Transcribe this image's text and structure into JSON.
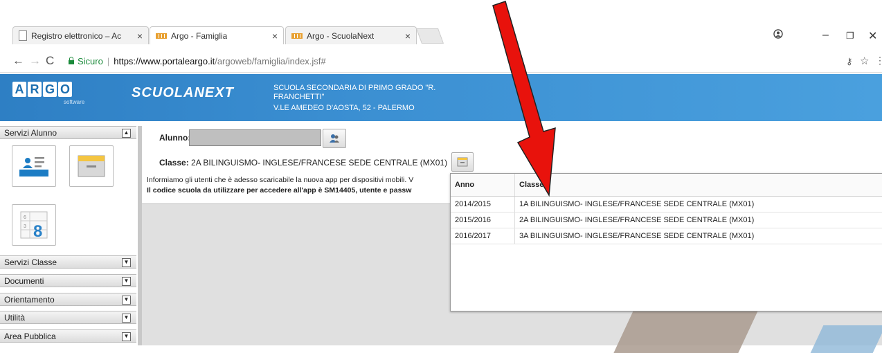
{
  "browser": {
    "tabs": [
      {
        "title": "Registro elettronico – Ac",
        "icon": "document-icon"
      },
      {
        "title": "Argo - Famiglia",
        "icon": "argo-favicon"
      },
      {
        "title": "Argo - ScuolaNext",
        "icon": "argo-favicon"
      }
    ],
    "secure_label": "Sicuro",
    "url_domain": "https://www.portaleargo.it",
    "url_path": "/argoweb/famiglia/index.jsf#"
  },
  "header": {
    "logo_letters": [
      "A",
      "R",
      "G",
      "O"
    ],
    "logo_sub": "software",
    "brand": "SCUOLANEXT",
    "school_line1": "SCUOLA SECONDARIA DI PRIMO GRADO \"R.",
    "school_line2": "FRANCHETTI\"",
    "school_line3": "V.LE AMEDEO D'AOSTA, 52 - PALERMO"
  },
  "sidebar": {
    "sections": [
      {
        "label": "Servizi Alunno",
        "toggle": "▲"
      },
      {
        "label": "Servizi Classe",
        "toggle": "▼"
      },
      {
        "label": "Documenti",
        "toggle": "▼"
      },
      {
        "label": "Orientamento",
        "toggle": "▼"
      },
      {
        "label": "Utilità",
        "toggle": "▼"
      },
      {
        "label": "Area Pubblica",
        "toggle": "▼"
      }
    ]
  },
  "main": {
    "alunno_label": "Alunno:",
    "classe_label": "Classe:",
    "classe_value": "2A BILINGUISMO- INGLESE/FRANCESE SEDE CENTRALE (MX01)",
    "info_line1": "Informiamo gli utenti che è adesso scaricabile la nuova app per dispositivi mobili. V",
    "info_line2": "Il codice scuola da utilizzare per accedere all'app è SM14405, utente e passw"
  },
  "popup": {
    "columns": [
      "Anno",
      "Classe"
    ],
    "rows": [
      [
        "2014/2015",
        "1A BILINGUISMO- INGLESE/FRANCESE SEDE CENTRALE (MX01)"
      ],
      [
        "2015/2016",
        "2A BILINGUISMO- INGLESE/FRANCESE SEDE CENTRALE (MX01)"
      ],
      [
        "2016/2017",
        "3A BILINGUISMO- INGLESE/FRANCESE SEDE CENTRALE (MX01)"
      ]
    ]
  },
  "colors": {
    "banner": "#3b8fd2",
    "arrow": "#e8120c",
    "secure": "#1a8a3a"
  }
}
